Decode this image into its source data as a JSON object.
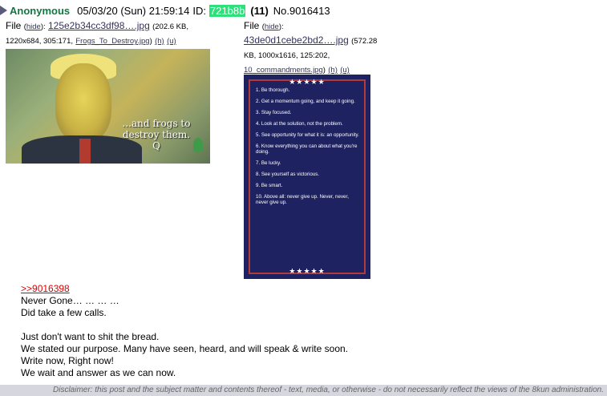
{
  "post": {
    "name": "Anonymous",
    "date": "05/03/20 (Sun) 21:59:14",
    "id_label": "ID:",
    "uid": "721b8b",
    "uid_color": "#2ee07a",
    "reply_count": "(11)",
    "post_number": "No.9016413"
  },
  "file1": {
    "label": "File",
    "hide_label": "hide",
    "filename": "125e2b34cc3df98….jpg",
    "info_size": "(202.6 KB,",
    "info_dims": "1220x684, 305:171,",
    "original_name": "Frogs_To_Destroy.jpg",
    "h_link": "(h)",
    "u_link": "(u)",
    "thumb_caption_1": "...and frogs to",
    "thumb_caption_2": "destroy them.",
    "thumb_caption_3": "Q"
  },
  "file2": {
    "label": "File",
    "hide_label": "hide",
    "filename": "43de0d1cebe2bd2….jpg",
    "info_size": "(572.28",
    "info_dims": "KB, 1000x1616, 125:202,",
    "original_name": "10_commandments.jpg",
    "h_link": "(h)",
    "u_link": "(u)",
    "stars_top": "★★★★★",
    "stars_bottom": "★★★★★",
    "commandments": [
      "1. Be thorough.",
      "2. Get a momentum going, and keep it going.",
      "3. Stay focused.",
      "4. Look at the solution, not the problem.",
      "5. See opportunity for what it is: an opportunity.",
      "6. Know everything you can about what you're doing.",
      "7. Be lucky.",
      "8. See yourself as victorious.",
      "9. Be smart.",
      "10. Above all: never give up. Never, never, never give up."
    ]
  },
  "body": {
    "reply_link": ">>9016398",
    "lines": [
      "Never Gone… … … …",
      "Did take a few calls.",
      "",
      "Just don't want to shit the bread.",
      "We stated our purpose. Many have seen, heard, and will speak & write soon.",
      "Write now, Right now!",
      "We wait and answer as we can now."
    ]
  },
  "disclaimer": "Disclaimer: this post and the subject matter and contents thereof - text, media, or otherwise - do not necessarily reflect the views of the 8kun administration."
}
